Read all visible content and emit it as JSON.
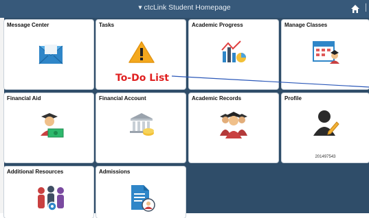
{
  "topbar": {
    "title": "▾ ctcLink Student Homepage",
    "home_icon": "home-icon",
    "overflow_text": "│"
  },
  "annotation": {
    "callout": "To-Do List",
    "color": "#e02020",
    "line_color": "#2a57b8"
  },
  "tiles": [
    {
      "name": "Message Center",
      "icon": "envelope-icon"
    },
    {
      "name": "Tasks",
      "icon": "warning-icon"
    },
    {
      "name": "Academic Progress",
      "icon": "chart-icon"
    },
    {
      "name": "Manage Classes",
      "icon": "calendar-student-icon"
    },
    {
      "name": "Financial Aid",
      "icon": "graduate-money-icon"
    },
    {
      "name": "Financial Account",
      "icon": "bank-icon"
    },
    {
      "name": "Academic Records",
      "icon": "graduates-icon"
    },
    {
      "name": "Profile",
      "icon": "profile-icon",
      "id_number": "201497543"
    },
    {
      "name": "Additional Resources",
      "icon": "people-gear-icon"
    },
    {
      "name": "Admissions",
      "icon": "application-icon"
    }
  ],
  "colors": {
    "header": "#37597a",
    "background": "#2f4d69",
    "tile": "#ffffff"
  }
}
